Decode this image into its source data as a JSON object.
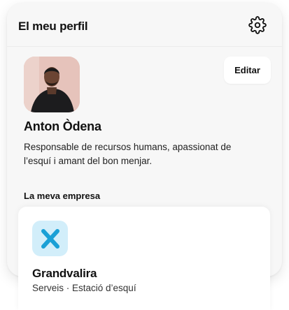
{
  "header": {
    "title": "El meu perfil",
    "settings_icon": "gear-icon"
  },
  "profile": {
    "name": "Anton Òdena",
    "bio": "Responsable de recursos humans, apassionat de l’esquí i amant del bon menjar.",
    "edit_label": "Editar",
    "avatar_icon": "person-avatar"
  },
  "company": {
    "heading": "La meva empresa",
    "name": "Grandvalira",
    "subtitle": "Serveis · Estació d’esquí",
    "logo_icon": "x-logo",
    "logo_color": "#1aa0d6",
    "logo_bg": "#d2eefa"
  }
}
